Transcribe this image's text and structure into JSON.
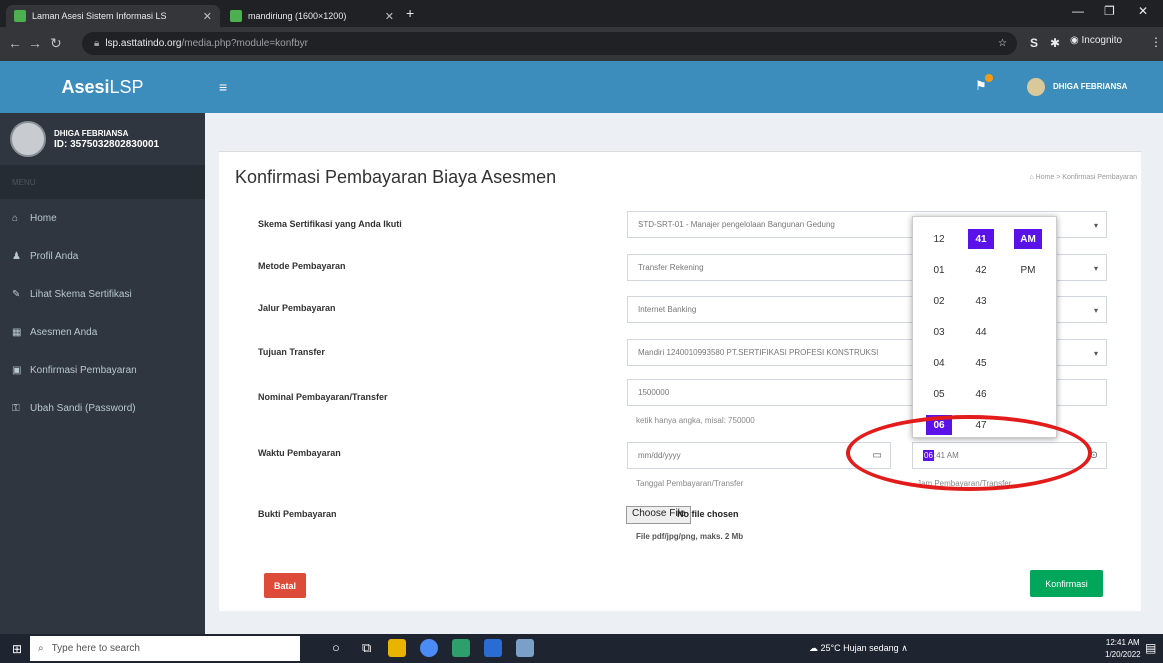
{
  "browser": {
    "tabs": [
      {
        "title": "Laman Asesi Sistem Informasi LS"
      },
      {
        "title": "mandiriung (1600×1200)"
      }
    ],
    "new_tab": "+",
    "url_host": "lsp.asttatindo.org",
    "url_path": "/media.php?module=konfbyr",
    "profile": "Incognito"
  },
  "app": {
    "brand_bold": "Asesi",
    "brand_rest": " LSP",
    "user_name": "DHIGA FEBRIANSA",
    "user_id": "ID: 3575032802830001",
    "nav_header": "MENU",
    "nav": [
      {
        "icon": "home-icon",
        "glyph": "⌂",
        "label": "Home"
      },
      {
        "icon": "user-icon",
        "glyph": "♟",
        "label": "Profil Anda"
      },
      {
        "icon": "edit-icon",
        "glyph": "✎",
        "label": "Lihat Skema Sertifikasi"
      },
      {
        "icon": "calendar-icon",
        "glyph": "▦",
        "label": "Asesmen Anda"
      },
      {
        "icon": "card-icon",
        "glyph": "▣",
        "label": "Konfirmasi Pembayaran"
      },
      {
        "icon": "key-icon",
        "glyph": "⚿",
        "label": "Ubah Sandi (Password)"
      }
    ],
    "top_user": "DHIGA FEBRIANSA"
  },
  "page": {
    "title": "Konfirmasi Pembayaran Biaya Asesmen",
    "breadcrumb": "Home > Konfirmasi Pembayaran"
  },
  "form": {
    "skema_label": "Skema Sertifikasi yang Anda Ikuti",
    "skema_value": "STD-SRT-01 - Manajer pengelolaan Bangunan Gedung",
    "metode_label": "Metode Pembayaran",
    "metode_value": "Transfer Rekening",
    "jalur_label": "Jalur Pembayaran",
    "jalur_value": "Internet Banking",
    "tujuan_label": "Tujuan Transfer",
    "tujuan_value": "Mandiri 1240010993580 PT.SERTIFIKASI PROFESI KONSTRUKSI",
    "nominal_label": "Nominal Pembayaran/Transfer",
    "nominal_value": "1500000",
    "nominal_help": "ketik hanya angka, misal: 750000",
    "waktu_label": "Waktu Pembayaran",
    "date_placeholder": "mm/dd/yyyy",
    "date_help": "Tanggal Pembayaran/Transfer",
    "time_hour": "06",
    "time_rest": ":41 AM",
    "time_help": "Jam Pembayaran/Transfer",
    "bukti_label": "Bukti Pembayaran",
    "file_button": "Choose File",
    "file_status": "No file chosen",
    "file_help": "File pdf/jpg/png, maks. 2 Mb",
    "cancel": "Batal",
    "confirm": "Konfirmasi"
  },
  "time_picker": {
    "hours": [
      "12",
      "01",
      "02",
      "03",
      "04",
      "05",
      "06"
    ],
    "minutes": [
      "41",
      "42",
      "43",
      "44",
      "45",
      "46",
      "47"
    ],
    "ampm": [
      "AM",
      "PM"
    ],
    "selected_hour": "06",
    "selected_minute": "41",
    "selected_ampm": "AM"
  },
  "taskbar": {
    "search_placeholder": "Type here to search",
    "weather": "25°C  Hujan sedang",
    "time": "12:41 AM",
    "date": "1/20/2022"
  },
  "colors": {
    "header": "#3c8dbc",
    "sidebar": "#2f3640",
    "danger": "#dd4b39",
    "success": "#00a65a",
    "picker_selected": "#5b12e8",
    "annotation": "#e31b1b"
  }
}
